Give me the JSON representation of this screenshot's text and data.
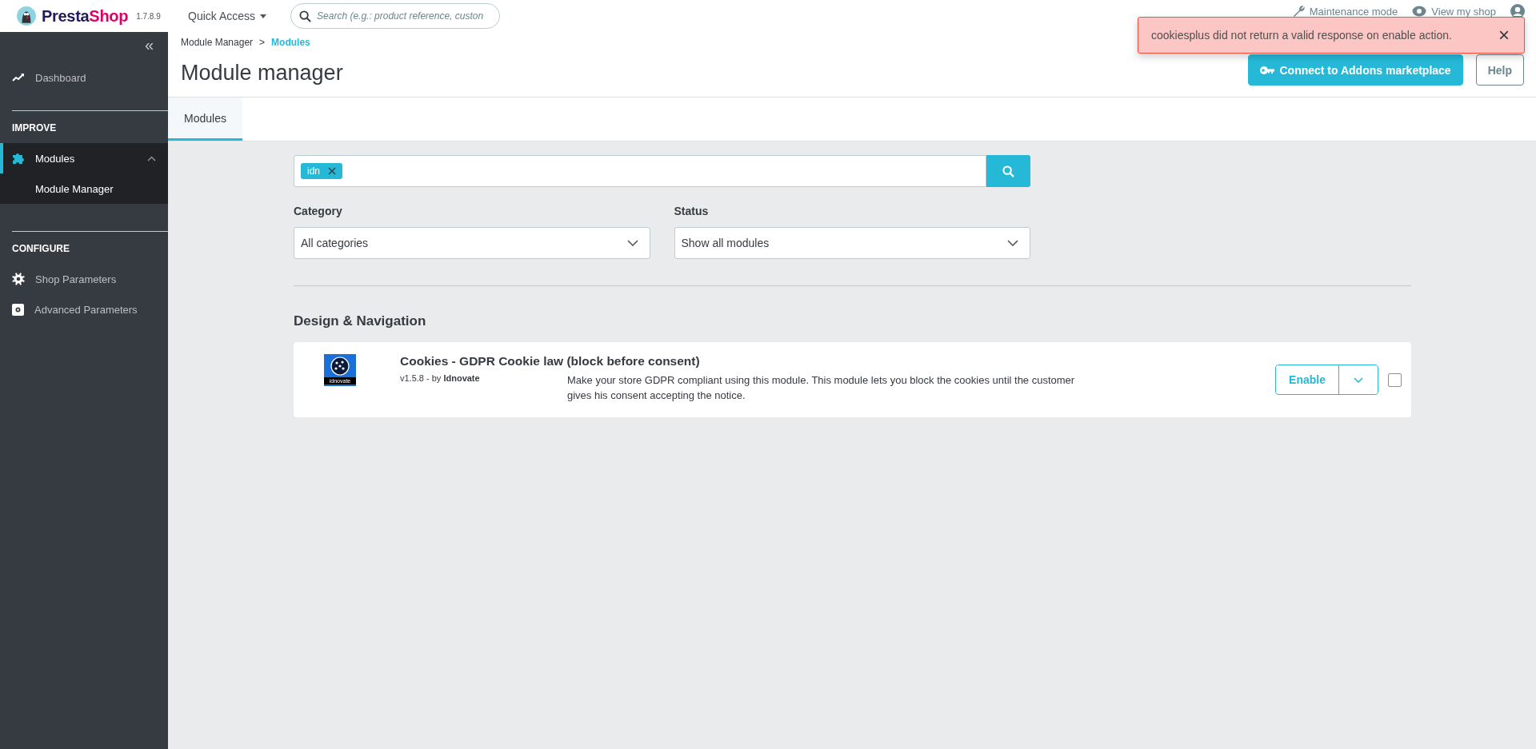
{
  "header": {
    "brand": [
      "Presta",
      "Shop"
    ],
    "version": "1.7.8.9",
    "quick_access": "Quick Access",
    "search": {
      "placeholder": "Search (e.g.: product reference, custon"
    },
    "links": [
      {
        "kind": "maintenance",
        "label": "Maintenance mode"
      },
      {
        "kind": "shop",
        "label": "View my shop"
      }
    ]
  },
  "alert": {
    "message": "cookiesplus did not return a valid response on enable action.",
    "close": "×"
  },
  "sidebar": {
    "collapse": "«",
    "top": [
      {
        "label": "Dashboard",
        "selected": false
      }
    ],
    "sections": [
      {
        "title": "IMPROVE",
        "items": [
          {
            "label": "Modules",
            "selected": true,
            "expanded": true,
            "children": [
              {
                "label": "Module Manager",
                "selected": false
              }
            ]
          }
        ]
      },
      {
        "title": "CONFIGURE",
        "items": [
          {
            "label": "Shop Parameters",
            "selected": false
          },
          {
            "label": "Advanced Parameters",
            "selected": false
          }
        ]
      }
    ]
  },
  "breadcrumb": [
    "Module Manager",
    "Modules"
  ],
  "breadcrumb_separator": ">",
  "title": "Module manager",
  "actions": [
    {
      "kind": "primary",
      "label": "Connect to Addons marketplace"
    },
    {
      "kind": "secondary",
      "label": "Help"
    }
  ],
  "tabs": [
    {
      "label": "Modules",
      "selected": true
    }
  ],
  "filter": {
    "tags": [
      "idn"
    ],
    "category": {
      "label": "Category",
      "value": "All categories"
    },
    "status": {
      "label": "Status",
      "value": "Show all modules"
    }
  },
  "section_title": "Design & Navigation",
  "modules": [
    {
      "name": "Cookies - GDPR Cookie law (block before consent)",
      "logo_text": "idnovate",
      "version": "v1.5.8 - by ",
      "author": "Idnovate",
      "description": "Make your store GDPR compliant using this module. This module lets you block the cookies until the customer gives his consent accepting the notice.",
      "action": "Enable",
      "checked": false
    }
  ]
}
